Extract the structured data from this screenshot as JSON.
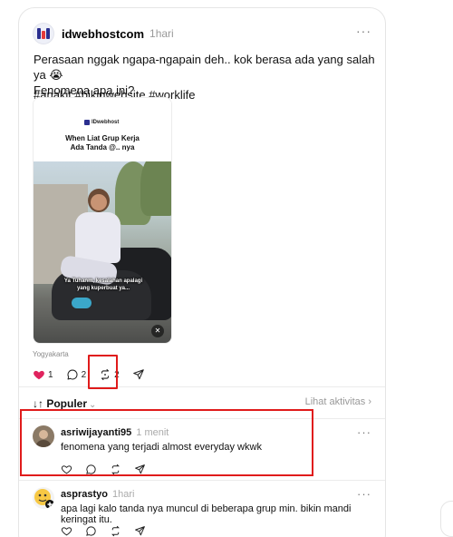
{
  "post": {
    "author": "idwebhostcom",
    "time": "1hari",
    "more_label": "···",
    "text_line1": "Perasaan nggak ngapa-ngapain deh.. kok berasa ada yang salah ya 😭",
    "text_line2": "Fenomena apa ini?",
    "hashtags": "#anakit #bikinwebsite #worklife",
    "media": {
      "brand": "IDwebhost",
      "title_line1": "When Liat Grup Kerja",
      "title_line2": "Ada Tanda @.. nya",
      "caption_line1": "Ya Tuhanm, kesalahan apalagi",
      "caption_line2": "yang kuperbuat ya...",
      "mute_icon": "speaker-muted-icon"
    },
    "location": "Yogyakarta",
    "actions": {
      "like_count": "1",
      "reply_count": "2",
      "repost_count": "2"
    }
  },
  "sort": {
    "label": "Populer",
    "activity_label": "Lihat aktivitas"
  },
  "comments": [
    {
      "author": "asriwijayanti95",
      "time": "1 menit",
      "text": "fenomena yang terjadi almost everyday wkwk",
      "more_label": "···"
    },
    {
      "author": "asprastyo",
      "time": "1hari",
      "text": "apa lagi kalo tanda nya muncul di beberapa grup min. bikin mandi keringat itu.",
      "more_label": "···"
    }
  ],
  "colors": {
    "like": "#e0245e",
    "highlight": "#e01b1b",
    "muted_text": "#999999"
  }
}
